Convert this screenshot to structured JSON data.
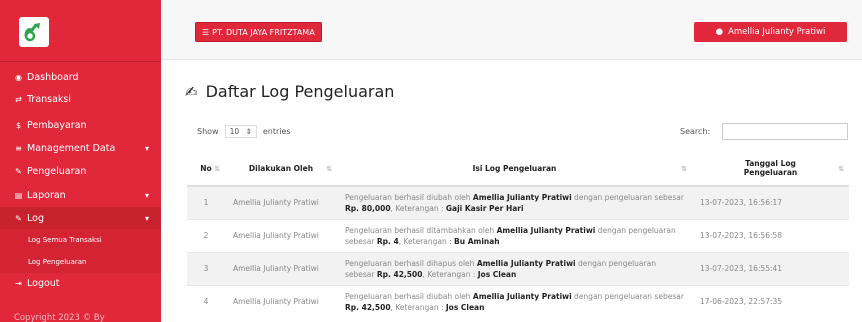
{
  "sidebar": {
    "items": [
      {
        "label": "Dashboard",
        "icon": "dashboard-icon"
      },
      {
        "label": "Transaksi",
        "icon": "transaction-icon"
      },
      {
        "label": "Pembayaran",
        "icon": "dollar-icon"
      },
      {
        "label": "Management Data",
        "icon": "list-icon"
      },
      {
        "label": "Pengeluaran",
        "icon": "edit-icon"
      },
      {
        "label": "Laporan",
        "icon": "report-icon"
      },
      {
        "label": "Log",
        "icon": "log-icon"
      },
      {
        "label": "Log Semua Transaksi"
      },
      {
        "label": "Log Pengeluaran"
      },
      {
        "label": "Logout",
        "icon": "logout-icon"
      }
    ],
    "copyright": "Copyright 2023 © By"
  },
  "topbar": {
    "company": "PT. DUTA JAYA FRITZTAMA",
    "user": "Amellia Julianty Pratiwi"
  },
  "main": {
    "title": "Daftar Log Pengeluaran",
    "show_label": "Show",
    "entries_value": "10",
    "entries_label": "entries",
    "search_label": "Search:",
    "table": {
      "headers": [
        "No",
        "Dilakukan Oleh",
        "Isi Log Pengeluaran",
        "Tanggal Log Pengeluaran"
      ],
      "rows": [
        {
          "no": "1",
          "by": "Amellia Julianty Pratiwi",
          "p1": "Pengeluaran berhasil diubah oleh ",
          "b1": "Amellia Julianty Pratiwi",
          "p2": " dengan pengeluaran sebesar ",
          "b2": "Rp. 80,000",
          "p3": ", Keterangan : ",
          "b3": "Gaji Kasir Per Hari",
          "tgl": "13-07-2023, 16:56:17"
        },
        {
          "no": "2",
          "by": "Amellia Julianty Pratiwi",
          "p1": "Pengeluaran berhasil ditambahkan oleh ",
          "b1": "Amellia Julianty Pratiwi",
          "p2": " dengan pengeluaran sebesar ",
          "b2": "Rp. 4",
          "p3": ", Keterangan : ",
          "b3": "Bu Aminah",
          "tgl": "13-07-2023, 16:56:58"
        },
        {
          "no": "3",
          "by": "Amellia Julianty Pratiwi",
          "p1": "Pengeluaran berhasil dihapus oleh ",
          "b1": "Amellia Julianty Pratiwi",
          "p2": " dengan pengeluaran sebesar ",
          "b2": "Rp. 42,500",
          "p3": ", Keterangan : ",
          "b3": "Jos Clean",
          "tgl": "13-07-2023, 16:55:41"
        },
        {
          "no": "4",
          "by": "Amellia Julianty Pratiwi",
          "p1": "Pengeluaran berhasil diubah oleh ",
          "b1": "Amellia Julianty Pratiwi",
          "p2": " dengan pengeluaran sebesar ",
          "b2": "Rp. 42,500",
          "p3": ", Keterangan : ",
          "b3": "Jos Clean",
          "tgl": "17-06-2023, 22:57:35"
        }
      ]
    }
  },
  "colors": {
    "accent": "#e0283a",
    "accent_dark": "#c8222f"
  }
}
